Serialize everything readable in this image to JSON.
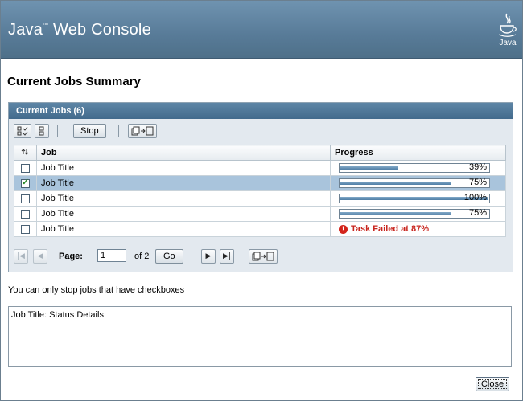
{
  "banner": {
    "app_name": "Java",
    "tm": "™",
    "app_suffix": " Web Console",
    "logo_text": "Java"
  },
  "page": {
    "title": "Current Jobs Summary"
  },
  "table": {
    "caption": "Current Jobs (6)",
    "actions": {
      "select_all_icon": "select-all-icon",
      "deselect_all_icon": "deselect-all-icon",
      "stop_label": "Stop",
      "toggle_view_icon": "pagination-toggle-icon"
    },
    "columns": {
      "sort": "sort-icon",
      "job": "Job",
      "progress": "Progress"
    },
    "rows": [
      {
        "job": "Job Title",
        "checked": false,
        "selected": false,
        "progress": 39,
        "progress_label": "39%"
      },
      {
        "job": "Job Title",
        "checked": true,
        "selected": true,
        "progress": 75,
        "progress_label": "75%"
      },
      {
        "job": "Job Title",
        "checked": false,
        "selected": false,
        "progress": 100,
        "progress_label": "100%"
      },
      {
        "job": "Job Title",
        "checked": false,
        "selected": false,
        "progress": 75,
        "progress_label": "75%"
      },
      {
        "job": "Job Title",
        "checked": false,
        "selected": false,
        "failed_text": "Task Failed at 87%"
      }
    ],
    "pager": {
      "page_label": "Page:",
      "current_page": "1",
      "of_label": "of 2",
      "go_label": "Go"
    }
  },
  "note": "You can only stop jobs that have checkboxes",
  "details": {
    "text": "Job Title: Status Details"
  },
  "close_label": "Close"
}
